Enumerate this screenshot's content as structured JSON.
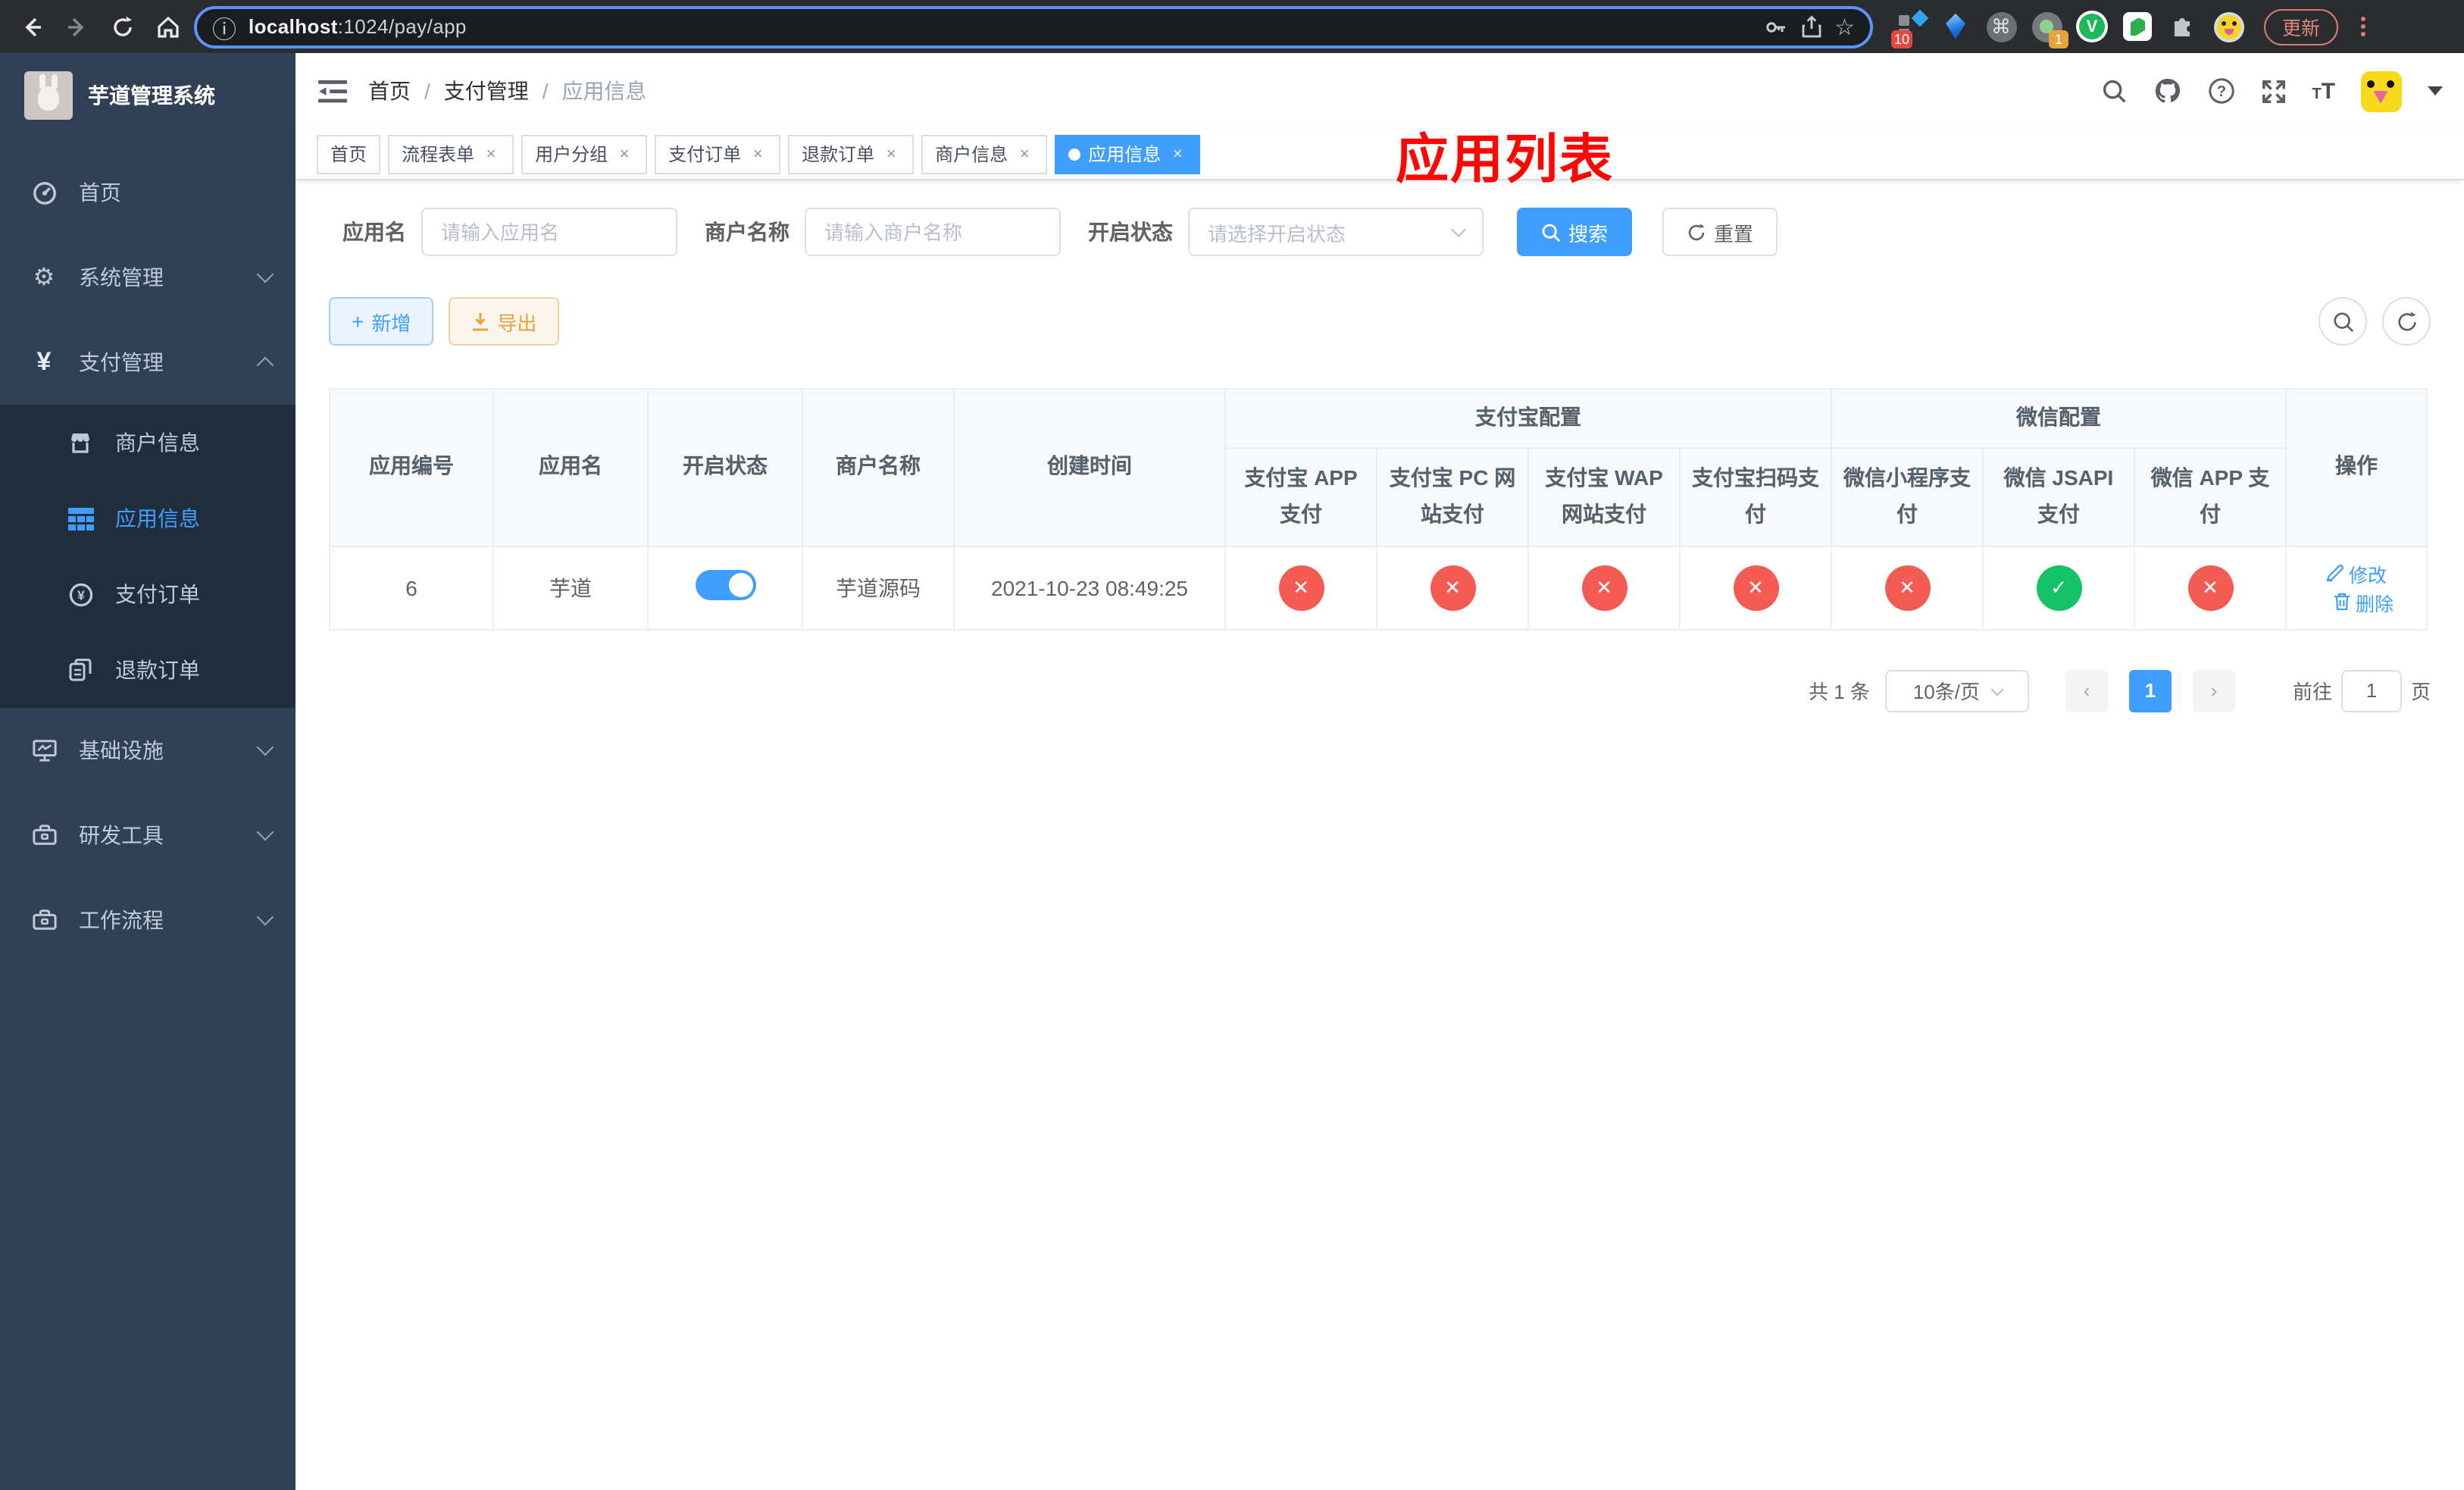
{
  "browser": {
    "url_host": "localhost",
    "url_rest": ":1024/pay/app",
    "update_label": "更新",
    "ext_badge_primary": "10",
    "ext_badge_secondary": "1",
    "vue_ext_letter": "V"
  },
  "sidebar": {
    "title": "芋道管理系统",
    "items": [
      {
        "label": "首页",
        "icon": "dashboard-icon"
      },
      {
        "label": "系统管理",
        "icon": "gear-icon"
      },
      {
        "label": "支付管理",
        "icon": "yen-icon"
      },
      {
        "label": "商户信息",
        "icon": "shop-icon"
      },
      {
        "label": "应用信息",
        "icon": "grid-icon"
      },
      {
        "label": "支付订单",
        "icon": "coin-icon"
      },
      {
        "label": "退款订单",
        "icon": "documents-icon"
      },
      {
        "label": "基础设施",
        "icon": "monitor-icon"
      },
      {
        "label": "研发工具",
        "icon": "toolbox-icon"
      },
      {
        "label": "工作流程",
        "icon": "toolbox-icon"
      }
    ]
  },
  "header": {
    "breadcrumb": [
      "首页",
      "支付管理",
      "应用信息"
    ],
    "breadcrumb_sep": "/",
    "overlay_title": "应用列表"
  },
  "tabs": [
    {
      "label": "首页"
    },
    {
      "label": "流程表单"
    },
    {
      "label": "用户分组"
    },
    {
      "label": "支付订单"
    },
    {
      "label": "退款订单"
    },
    {
      "label": "商户信息"
    },
    {
      "label": "应用信息"
    }
  ],
  "filters": {
    "app_name_label": "应用名",
    "app_name_placeholder": "请输入应用名",
    "merchant_label": "商户名称",
    "merchant_placeholder": "请输入商户名称",
    "status_label": "开启状态",
    "status_placeholder": "请选择开启状态",
    "search_label": "搜索",
    "reset_label": "重置"
  },
  "toolbar": {
    "add_label": "新增",
    "export_label": "导出"
  },
  "table": {
    "group_alipay": "支付宝配置",
    "group_wechat": "微信配置",
    "columns": [
      "应用编号",
      "应用名",
      "开启状态",
      "商户名称",
      "创建时间",
      "支付宝 APP 支付",
      "支付宝 PC 网站支付",
      "支付宝 WAP 网站支付",
      "支付宝扫码支付",
      "微信小程序支付",
      "微信 JSAPI 支付",
      "微信 APP 支付",
      "操作"
    ],
    "row": {
      "id": "6",
      "name": "芋道",
      "enabled": true,
      "merchant": "芋道源码",
      "created": "2021-10-23 08:49:25",
      "channel_flags": [
        false,
        false,
        false,
        false,
        false,
        true,
        false
      ],
      "edit_label": "修改",
      "delete_label": "删除"
    }
  },
  "pagination": {
    "total": "共 1 条",
    "per_page": "10条/页",
    "page": "1",
    "goto_label": "前往",
    "goto_value": "1",
    "page_unit": "页"
  },
  "glyphs": {
    "check": "✓",
    "cross": "✕",
    "close": "×",
    "plus": "+",
    "info": "ⓘ",
    "star": "☆",
    "command": "⌘"
  },
  "colors": {
    "accent": "#409EFF",
    "success": "#15c268",
    "danger": "#f45b53",
    "warning": "#e6a23c",
    "sidebar": "#304156",
    "sidebar_sub": "#1f2d3d"
  }
}
